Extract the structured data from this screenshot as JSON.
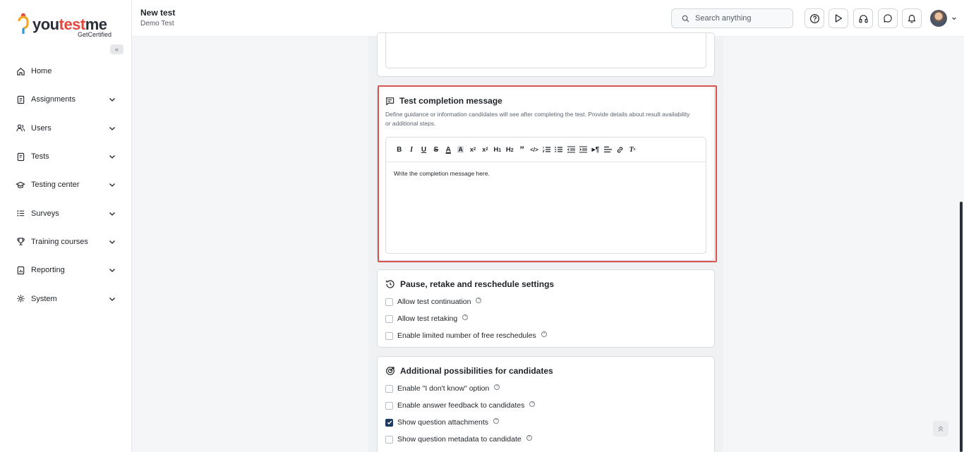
{
  "brand": {
    "name_part1": "you",
    "name_part2": "test",
    "name_part3": "me",
    "tagline": "GetCertified"
  },
  "header": {
    "title": "New test",
    "subtitle": "Demo Test",
    "search_placeholder": "Search anything"
  },
  "sidebar": {
    "items": [
      {
        "label": "Home",
        "icon": "home-icon",
        "has_children": false
      },
      {
        "label": "Assignments",
        "icon": "assignments-icon",
        "has_children": true
      },
      {
        "label": "Users",
        "icon": "users-icon",
        "has_children": true
      },
      {
        "label": "Tests",
        "icon": "tests-icon",
        "has_children": true
      },
      {
        "label": "Testing center",
        "icon": "testing-center-icon",
        "has_children": true
      },
      {
        "label": "Surveys",
        "icon": "surveys-icon",
        "has_children": true
      },
      {
        "label": "Training courses",
        "icon": "trophy-icon",
        "has_children": true
      },
      {
        "label": "Reporting",
        "icon": "reporting-icon",
        "has_children": true
      },
      {
        "label": "System",
        "icon": "gear-icon",
        "has_children": true
      }
    ]
  },
  "completion": {
    "title": "Test completion message",
    "description": "Define guidance or information candidates will see after completing the test. Provide details about result availability or additional steps.",
    "editor_text": "Write the completion message here."
  },
  "pause": {
    "title": "Pause, retake and reschedule settings",
    "options": [
      {
        "label": "Allow test continuation",
        "checked": false
      },
      {
        "label": "Allow test retaking",
        "checked": false
      },
      {
        "label": "Enable limited number of free reschedules",
        "checked": false
      }
    ]
  },
  "additional": {
    "title": "Additional possibilities for candidates",
    "options": [
      {
        "label": "Enable \"I don't know\" option",
        "checked": false
      },
      {
        "label": "Enable answer feedback to candidates",
        "checked": false
      },
      {
        "label": "Show question attachments",
        "checked": true
      },
      {
        "label": "Show question metadata to candidate",
        "checked": false
      }
    ]
  },
  "colors": {
    "accent": "#e2483d",
    "highlight": "#d9534f",
    "checkbox_checked": "#1e3a5f"
  }
}
